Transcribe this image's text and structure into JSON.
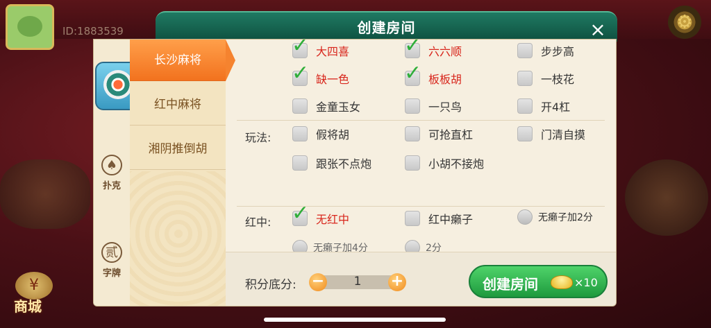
{
  "background": {
    "id_text": "ID:1883539",
    "shop_label": "商城"
  },
  "dialog": {
    "title": "创建房间",
    "close_label": "×"
  },
  "side_tabs": [
    {
      "label": "",
      "icon": "mahjong-tile-icon"
    },
    {
      "label": "扑克",
      "icon": "spade-icon",
      "glyph": "♠"
    },
    {
      "label": "字牌",
      "icon": "character-tile-icon",
      "glyph": "贰"
    }
  ],
  "game_list": [
    {
      "label": "长沙麻将",
      "active": true
    },
    {
      "label": "红中麻将",
      "active": false
    },
    {
      "label": "湘阴推倒胡",
      "active": false
    }
  ],
  "options": {
    "row1": [
      {
        "label": "大四喜",
        "checked": true
      },
      {
        "label": "六六顺",
        "checked": true
      },
      {
        "label": "步步高",
        "checked": false
      }
    ],
    "row2": [
      {
        "label": "缺一色",
        "checked": true
      },
      {
        "label": "板板胡",
        "checked": true
      },
      {
        "label": "一枝花",
        "checked": false
      }
    ],
    "row3": [
      {
        "label": "金童玉女",
        "checked": false
      },
      {
        "label": "一只鸟",
        "checked": false
      },
      {
        "label": "开4杠",
        "checked": false
      }
    ],
    "wanfa_label": "玩法:",
    "row4": [
      {
        "label": "假将胡",
        "checked": false
      },
      {
        "label": "可抢直杠",
        "checked": false
      },
      {
        "label": "门清自摸",
        "checked": false
      }
    ],
    "row5": [
      {
        "label": "跟张不点炮",
        "checked": false
      },
      {
        "label": "小胡不接炮",
        "checked": false
      }
    ],
    "hongzhong_label": "红中:",
    "hongzhong": [
      {
        "label": "无红中",
        "checked": true
      },
      {
        "label": "红中癞子",
        "checked": false
      }
    ],
    "radio1": {
      "label": "无癞子加2分"
    },
    "radio2": {
      "label": "无癞子加4分"
    },
    "radio3": {
      "label": "2分"
    }
  },
  "bottom": {
    "score_label": "积分底分:",
    "score_value": "1",
    "minus": "−",
    "plus": "+",
    "create_label": "创建房间",
    "cost": "×10"
  },
  "colors": {
    "accent_orange": "#f2721e",
    "create_green": "#1e9a3e",
    "checked_red": "#d8261c",
    "tick_green": "#2fae3a"
  }
}
